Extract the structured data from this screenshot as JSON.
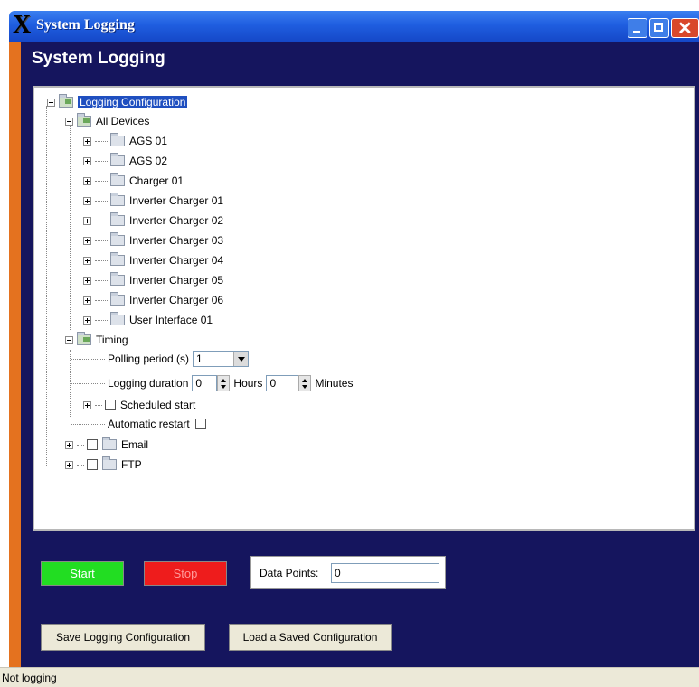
{
  "window": {
    "title": "System Logging"
  },
  "header": {
    "title": "System Logging"
  },
  "tree": {
    "root": "Logging Configuration",
    "all_devices": "All Devices",
    "devices": [
      "AGS 01",
      "AGS 02",
      "Charger 01",
      "Inverter Charger 01",
      "Inverter Charger 02",
      "Inverter Charger 03",
      "Inverter Charger 04",
      "Inverter Charger 05",
      "Inverter Charger 06",
      "User Interface 01"
    ],
    "timing": {
      "label": "Timing",
      "polling_label": "Polling period (s)",
      "polling_value": "1",
      "duration_label": "Logging duration",
      "hours_value": "0",
      "hours_label": "Hours",
      "minutes_value": "0",
      "minutes_label": "Minutes",
      "scheduled_label": "Scheduled start",
      "restart_label": "Automatic restart"
    },
    "email": "Email",
    "ftp": "FTP"
  },
  "controls": {
    "start_label": "Start",
    "stop_label": "Stop",
    "data_points_label": "Data Points:",
    "data_points_value": "0",
    "save_label": "Save Logging Configuration",
    "load_label": "Load a Saved Configuration"
  },
  "status": {
    "text": "Not logging"
  },
  "colors": {
    "navy": "#15155e",
    "orange": "#e4721f",
    "start_green": "#22dd22",
    "stop_red": "#ee1c1c",
    "titlebar_blue": "#1f5ee0"
  }
}
